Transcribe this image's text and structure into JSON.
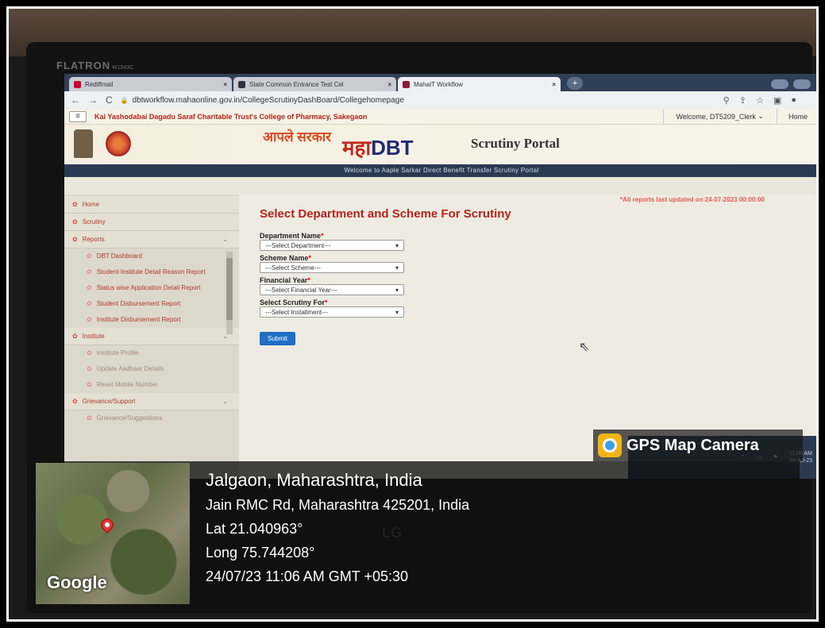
{
  "bezel": {
    "brand": "FLATRON",
    "model": "W1943C",
    "maker": "LG"
  },
  "browser": {
    "tabs": [
      {
        "title": "Rediffmail",
        "active": false
      },
      {
        "title": "State Common Entrance Test Cel",
        "active": false
      },
      {
        "title": "MahaIT Workflow",
        "active": true
      }
    ],
    "url": "dbtworkflow.mahaonline.gov.in/CollegeScrutinyDashBoard/Collegehomepage"
  },
  "site": {
    "college_name": "Kai Yashodabai Dagadu Saraf Charitable Trust's College of Pharmacy, Sakegaon",
    "welcome_user": "Welcome, DT5209_Clerk",
    "home_link": "Home",
    "aaple_sarkar": "आपले सरकार",
    "maha": "महा",
    "dbt": "DBT",
    "portal_title": "Scrutiny Portal",
    "welcome_strip": "Welcome to Aaple Sarkar Direct Benefit Transfer Scrutiny Portal"
  },
  "sidebar": {
    "home": "Home",
    "scrutiny": "Scrutiny",
    "reports": "Reports",
    "report_items": [
      "DBT Dashboard",
      "Student-Institute Detail Reason Report",
      "Status wise Application Detail Report",
      "Student Disbursement Report",
      "Institute Disbursement Report"
    ],
    "institute": "Institute",
    "institute_items": [
      "Institute Profile",
      "Update Aadhaar Details",
      "Reset Mobile Number"
    ],
    "grievance": "Grievance/Support",
    "grievance_items": [
      "Grievance/Suggestions"
    ]
  },
  "main": {
    "title": "Select Department and Scheme For Scrutiny",
    "last_updated": "*All reports last updated on 24-07-2023 00:00:00",
    "fields": [
      {
        "label": "Department Name",
        "value": "---Select Department---"
      },
      {
        "label": "Scheme Name",
        "value": "---Select Scheme---"
      },
      {
        "label": "Financial Year",
        "value": "---Select Financial Year---"
      },
      {
        "label": "Select Scrutiny For",
        "value": "---Select Installment---"
      }
    ],
    "submit_label": "Submit"
  },
  "tray": {
    "time": "11:06 AM",
    "date": "24-Jul-23"
  },
  "gps": {
    "app": "GPS Map Camera",
    "place": "Jalgaon, Maharashtra, India",
    "address": "Jain RMC Rd, Maharashtra 425201, India",
    "lat": "Lat 21.040963°",
    "long": "Long 75.744208°",
    "datetime": "24/07/23 11:06 AM GMT +05:30",
    "map_brand": "Google"
  }
}
